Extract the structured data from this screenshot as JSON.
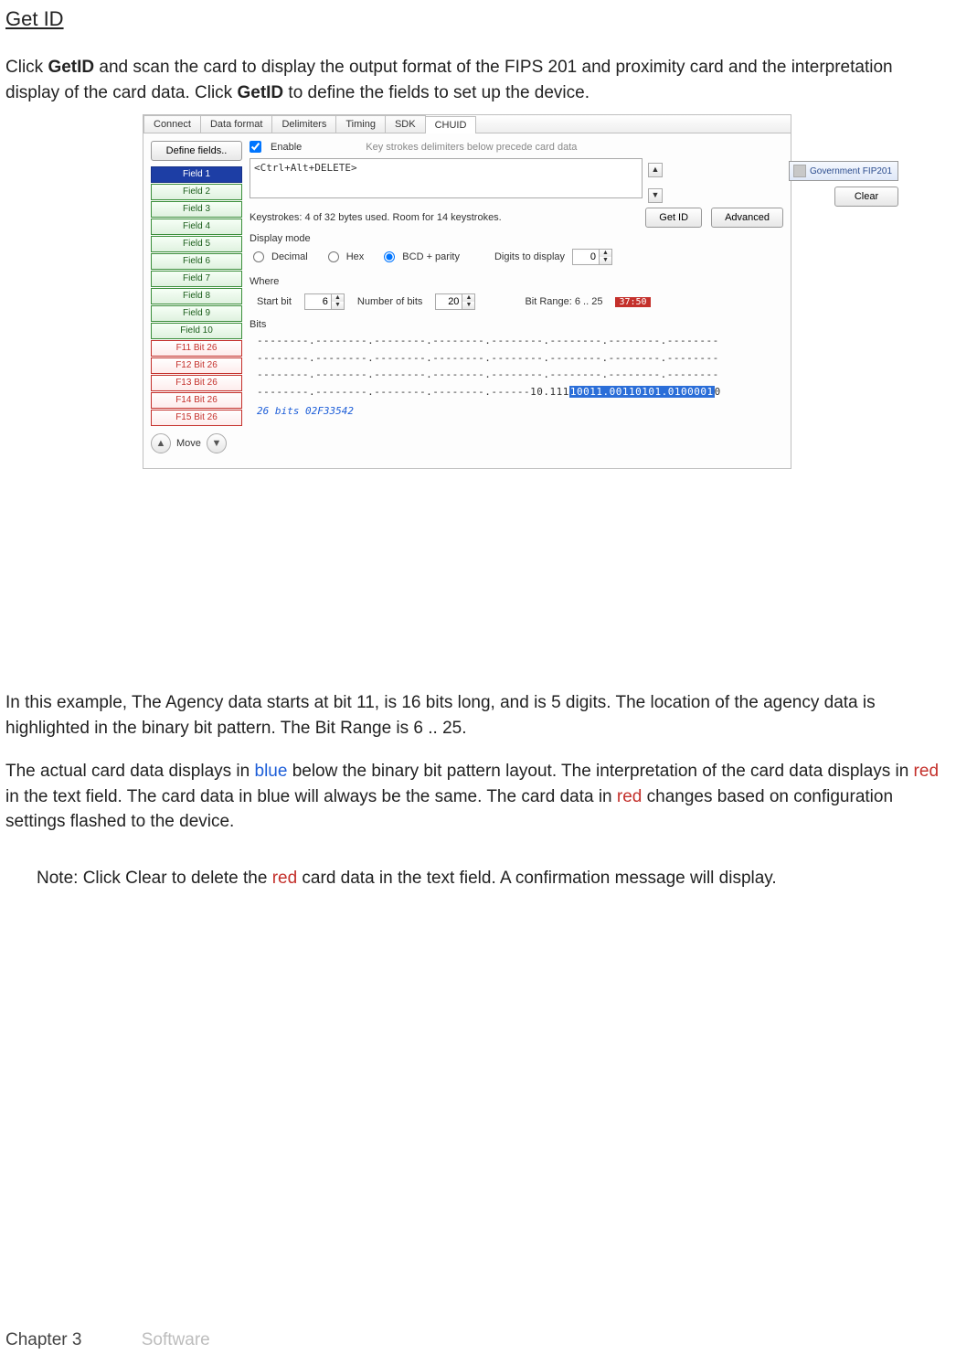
{
  "section_title": "Get ID",
  "intro_parts": {
    "p1a": "Click ",
    "p1b_bold": "GetID",
    "p1c": " and scan the card to display the output format of the FIPS 201 and proximity card and the interpretation display of the card data. Click ",
    "p1d_bold": "GetID",
    "p1e": " to define the fields to set up the device."
  },
  "tabs": [
    "Connect",
    "Data format",
    "Delimiters",
    "Timing",
    "SDK",
    "CHUID"
  ],
  "active_tab_index": 5,
  "define_label": "Define fields..",
  "fields": [
    "Field 1",
    "Field 2",
    "Field 3",
    "Field 4",
    "Field 5",
    "Field 6",
    "Field 7",
    "Field 8",
    "Field 9",
    "Field 10"
  ],
  "fields_red": [
    "F11 Bit 26",
    "F12 Bit 26",
    "F13 Bit 26",
    "F14 Bit 26",
    "F15 Bit 26"
  ],
  "move_label": "Move",
  "enable_label": "Enable",
  "hint_label": "Key strokes delimiters below precede card data",
  "textbox_value": "<Ctrl+Alt+DELETE>",
  "gov_label": "Government FIP201",
  "clear_label": "Clear",
  "status_text": "Keystrokes: 4 of 32 bytes used. Room for 14 keystrokes.",
  "getid_label": "Get ID",
  "advanced_label": "Advanced",
  "display_mode_label": "Display mode",
  "radios": {
    "decimal": "Decimal",
    "hex": "Hex",
    "bcd": "BCD + parity"
  },
  "digits_label": "Digits to display",
  "digits_value": "0",
  "where_label": "Where",
  "startbit_label": "Start bit",
  "startbit_value": "6",
  "numbits_label": "Number of bits",
  "numbits_value": "20",
  "bitrange_label": "Bit Range: 6 .. 25",
  "bitrange_red": "37:50",
  "bits_label": "Bits",
  "bit_lines": [
    "--------.--------.--------.--------.--------.--------.--------.--------",
    "--------.--------.--------.--------.--------.--------.--------.--------",
    "--------.--------.--------.--------.--------.--------.--------.--------"
  ],
  "bit_line4_pre": "--------.--------.--------.--------.------10.111",
  "bit_line4_hl": "10011.00110101.0100001",
  "bit_line4_post": "0",
  "interp_label": "26 bits 02F33542",
  "para2": "In this example, The Agency data starts at bit 11, is 16 bits long, and is 5 digits. The location of the agency data is highlighted in the binary bit pattern. The Bit Range is 6 .. 25.",
  "para3": {
    "a": "The actual card data displays in ",
    "b_blue": "blue",
    "c": " below the binary bit pattern layout. The interpretation of the card data displays in ",
    "d_red": "red",
    "e": " in the text field. The card data in blue will always be the same. The card data in ",
    "f_red": "red",
    "g": " changes based on configuration settings flashed to the device."
  },
  "note": {
    "a": "Note: Click Clear to delete the ",
    "b_red": "red",
    "c": " card data in the text field. A confirmation message will display."
  },
  "footer": {
    "chapter": "Chapter 3",
    "title": "Software"
  }
}
